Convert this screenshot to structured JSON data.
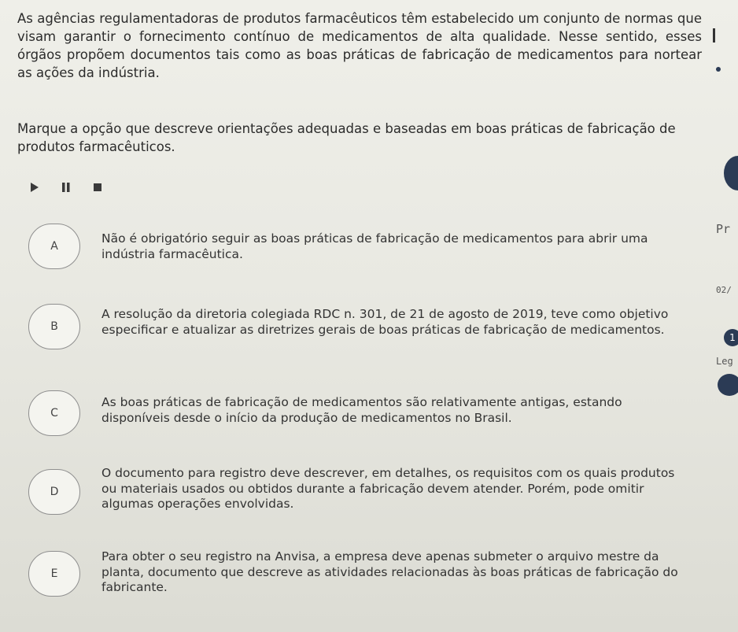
{
  "question": {
    "intro": "As agências regulamentadoras de produtos farmacêuticos têm estabelecido um conjunto de normas que visam garantir o fornecimento contínuo de medicamentos de alta qualidade. Nesse sentido, esses órgãos propõem documentos tais como as boas práticas de fabricação de medicamentos para nortear as ações da indústria.",
    "prompt": "Marque a opção que descreve orientações adequadas e baseadas em boas práticas de fabricação de produtos farmacêuticos."
  },
  "media_controls": {
    "icons": [
      "play-icon",
      "pause-icon",
      "stop-icon"
    ]
  },
  "options": [
    {
      "letter": "A",
      "text": "Não é obrigatório seguir as boas práticas de fabricação de medicamentos para abrir uma indústria farmacêutica."
    },
    {
      "letter": "B",
      "text": "A resolução da diretoria colegiada RDC n. 301, de 21 de agosto de 2019, teve como objetivo especificar e atualizar as diretrizes gerais de boas práticas de fabricação de medicamentos."
    },
    {
      "letter": "C",
      "text": "As boas práticas de fabricação de medicamentos são relativamente antigas, estando disponíveis desde o início da produção de medicamentos no Brasil."
    },
    {
      "letter": "D",
      "text": "O documento para registro deve descrever, em detalhes, os requisitos com os quais produtos ou materiais usados ou obtidos durante a fabricação devem atender. Porém, pode omitir algumas operações envolvidas."
    },
    {
      "letter": "E",
      "text": "Para obter o seu registro na Anvisa, a empresa deve apenas submeter o arquivo mestre da planta, documento que descreve as atividades relacionadas às boas práticas de fabricação do fabricante."
    }
  ],
  "side_panel": {
    "label_p": "Pr",
    "label_date": "02/",
    "label_badge": "1",
    "label_leg": "Leg"
  },
  "colors": {
    "accent": "#2b3b55",
    "text": "#2e2e2e",
    "background": "#ecece6"
  }
}
